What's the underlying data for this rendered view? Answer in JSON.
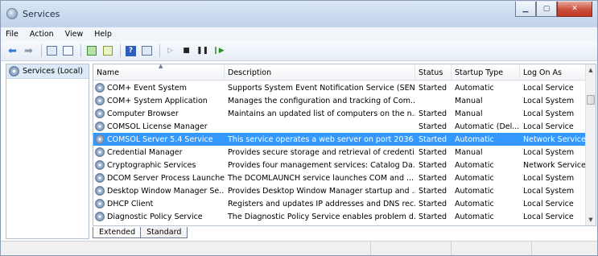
{
  "window": {
    "title": "Services"
  },
  "menu": [
    "File",
    "Action",
    "View",
    "Help"
  ],
  "toolbar": {
    "icons": [
      "back-icon",
      "forward-icon",
      "show-hide-tree-icon",
      "properties-icon",
      "refresh-icon",
      "export-list-icon",
      "help-icon",
      "show-action-pane-icon",
      "start-service-icon",
      "stop-service-icon",
      "pause-service-icon",
      "resume-service-icon"
    ]
  },
  "left_pane": {
    "node_label": "Services (Local)"
  },
  "table": {
    "columns": [
      "Name",
      "Description",
      "Status",
      "Startup Type",
      "Log On As"
    ],
    "rows": [
      {
        "name": "COM+ Event System",
        "description": "Supports System Event Notification Service (SEN...",
        "status": "Started",
        "startup": "Automatic",
        "logon": "Local Service"
      },
      {
        "name": "COM+ System Application",
        "description": "Manages the configuration and tracking of Com...",
        "status": "",
        "startup": "Manual",
        "logon": "Local System"
      },
      {
        "name": "Computer Browser",
        "description": "Maintains an updated list of computers on the n...",
        "status": "Started",
        "startup": "Manual",
        "logon": "Local System"
      },
      {
        "name": "COMSOL License Manager",
        "description": "",
        "status": "Started",
        "startup": "Automatic (Del...",
        "logon": "Local Service"
      },
      {
        "name": "COMSOL Server 5.4 Service",
        "description": "This service operates a web server on port 2036",
        "status": "Started",
        "startup": "Automatic",
        "logon": "Network Service",
        "selected": true
      },
      {
        "name": "Credential Manager",
        "description": "Provides secure storage and retrieval of credenti...",
        "status": "Started",
        "startup": "Manual",
        "logon": "Local System"
      },
      {
        "name": "Cryptographic Services",
        "description": "Provides four management services: Catalog Da...",
        "status": "Started",
        "startup": "Automatic",
        "logon": "Network Service"
      },
      {
        "name": "DCOM Server Process Launcher",
        "description": "The DCOMLAUNCH service launches COM and ...",
        "status": "Started",
        "startup": "Automatic",
        "logon": "Local System"
      },
      {
        "name": "Desktop Window Manager Se...",
        "description": "Provides Desktop Window Manager startup and ...",
        "status": "Started",
        "startup": "Automatic",
        "logon": "Local System"
      },
      {
        "name": "DHCP Client",
        "description": "Registers and updates IP addresses and DNS rec...",
        "status": "Started",
        "startup": "Automatic",
        "logon": "Local Service"
      },
      {
        "name": "Diagnostic Policy Service",
        "description": "The Diagnostic Policy Service enables problem d...",
        "status": "Started",
        "startup": "Automatic",
        "logon": "Local Service"
      }
    ]
  },
  "tabs": [
    "Extended",
    "Standard"
  ],
  "colors": {
    "selection": "#3399ff",
    "title_bar": "#c9d9ee",
    "close_button": "#c94f3a"
  }
}
